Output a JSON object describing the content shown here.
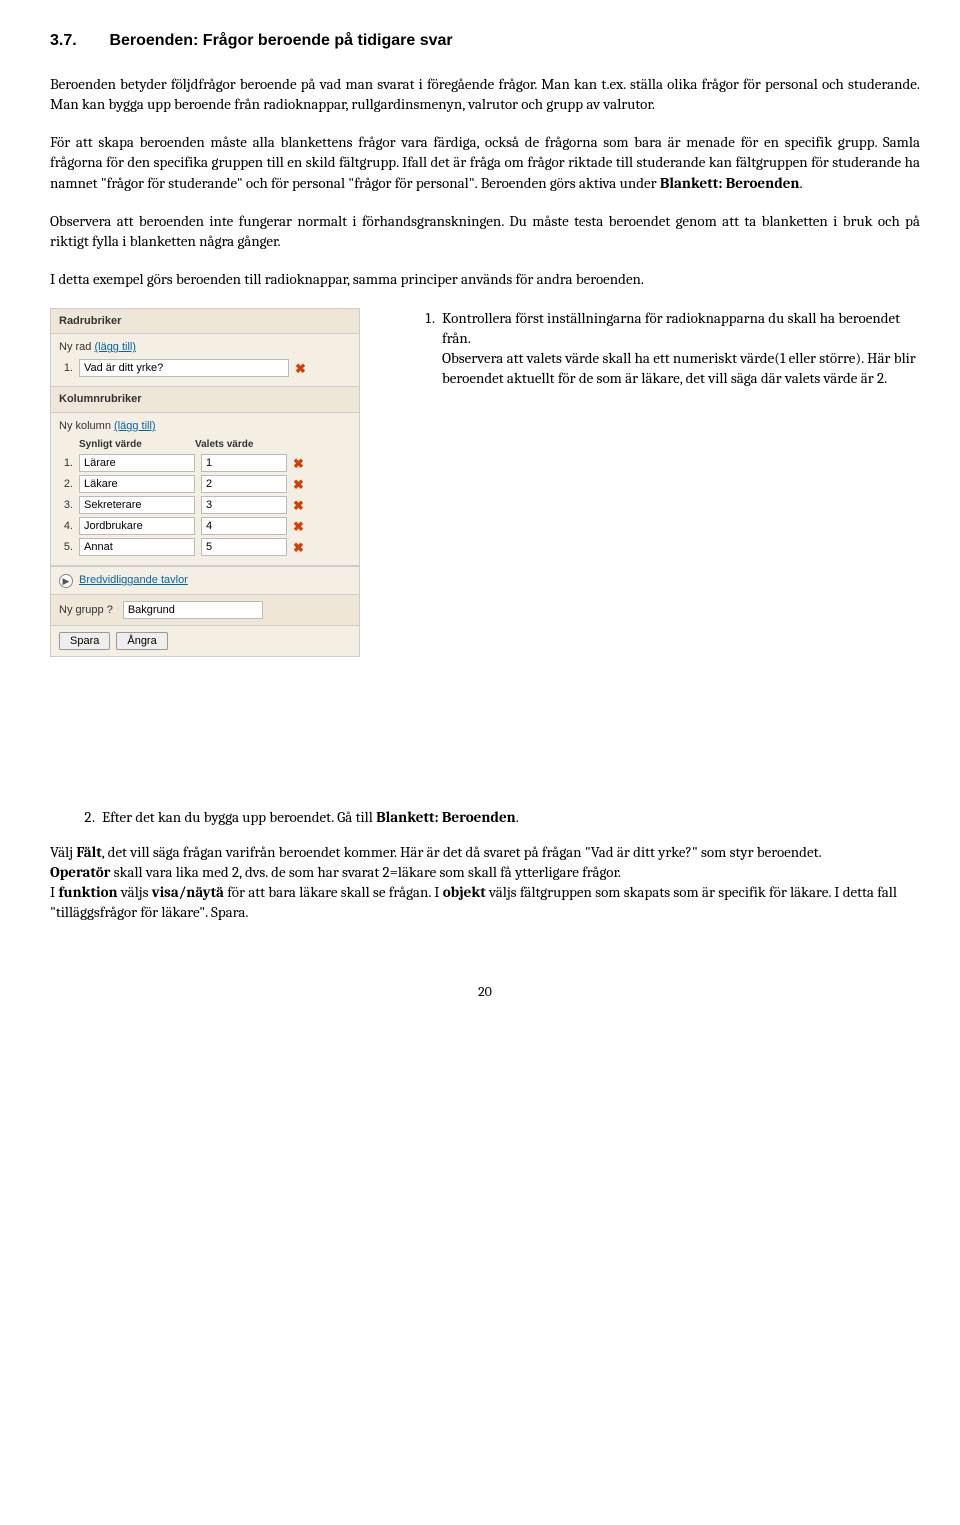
{
  "heading_num": "3.7.",
  "heading_text": "Beroenden: Frågor beroende på tidigare svar",
  "p1": "Beroenden betyder följdfrågor beroende på vad man svarat i föregående frågor. Man kan t.ex. ställa olika frågor för personal och studerande. Man kan bygga upp beroende från radioknappar, rullgardinsmenyn, valrutor och grupp av valrutor.",
  "p2a": "För att skapa beroenden måste alla blankettens frågor vara färdiga, också de frågorna som bara är menade för en specifik grupp. Samla frågorna för den specifika gruppen till en skild fältgrupp. Ifall det är fråga om frågor riktade till studerande kan fältgruppen för studerande ha namnet \"frågor för studerande\" och för personal \"frågor för personal\". Beroenden görs aktiva under ",
  "p2b_bold": "Blankett: Beroenden",
  "p2c": ".",
  "p3": "Observera att beroenden inte fungerar normalt i förhandsgranskningen. Du måste testa beroendet genom att ta blanketten i bruk och på riktigt fylla i blanketten några gånger.",
  "p4": "I detta exempel görs beroenden till radioknappar, samma principer används för andra beroenden.",
  "panel": {
    "radrubriker": "Radrubriker",
    "nyrad": "Ny rad",
    "laggtill": "(lägg till)",
    "row1_num": "1.",
    "row1_val": "Vad är ditt yrke?",
    "kolumnrubriker": "Kolumnrubriker",
    "nykolumn": "Ny kolumn",
    "head_synligt": "Synligt värde",
    "head_valets": "Valets värde",
    "rows": [
      {
        "n": "1.",
        "syn": "Lärare",
        "val": "1"
      },
      {
        "n": "2.",
        "syn": "Läkare",
        "val": "2"
      },
      {
        "n": "3.",
        "syn": "Sekreterare",
        "val": "3"
      },
      {
        "n": "4.",
        "syn": "Jordbrukare",
        "val": "4"
      },
      {
        "n": "5.",
        "syn": "Annat",
        "val": "5"
      }
    ],
    "bredvid": "Bredvidliggande tavlor",
    "nygrupp": "Ny grupp ?",
    "bakgrund": "Bakgrund",
    "spara": "Spara",
    "angra": "Ångra"
  },
  "step1a": "Kontrollera först inställningarna för radioknapparna du skall ha beroendet från.",
  "step1b": "Observera att valets värde skall ha ett numeriskt värde(1 eller större). Här blir beroendet aktuellt för de som är läkare, det vill säga där valets värde är 2.",
  "step2a": "Efter det kan du bygga upp beroendet. Gå till ",
  "step2b_bold": "Blankett: Beroenden",
  "step2c": ".",
  "p5a": "Välj ",
  "p5b_bold": "Fält",
  "p5c": ", det vill säga frågan varifrån beroendet kommer.  Här är det då svaret på frågan \"Vad är ditt yrke?\" som styr beroendet.",
  "p6a_bold": "Operatör",
  "p6a": " skall vara lika med 2, dvs. de som har svarat 2=läkare som skall få ytterligare frågor.",
  "p7a": "I ",
  "p7b_bold": "funktion",
  "p7c": " väljs ",
  "p7d_bold": "visa/näytä",
  "p7e": " för att bara läkare skall se frågan. I ",
  "p7f_bold": "objekt",
  "p7g": " väljs fältgruppen som skapats som är specifik för läkare. I detta fall \"tilläggsfrågor för läkare\". Spara.",
  "pagenum": "20"
}
